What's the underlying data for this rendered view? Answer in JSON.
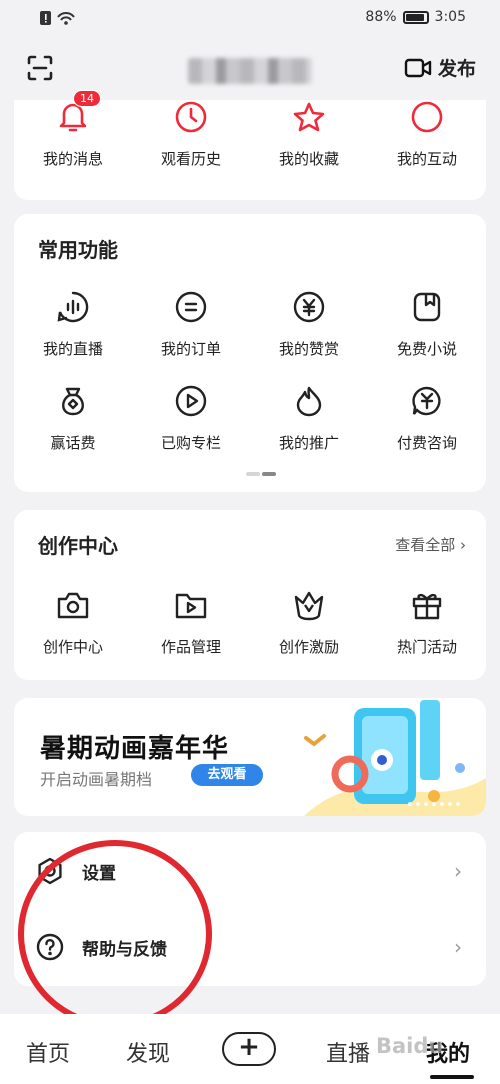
{
  "status": {
    "battery": "88%",
    "time": "3:05"
  },
  "header": {
    "publish_label": "发布"
  },
  "top_row": [
    {
      "label": "我的消息",
      "icon": "bell-icon",
      "badge": "14"
    },
    {
      "label": "观看历史",
      "icon": "clock-icon"
    },
    {
      "label": "我的收藏",
      "icon": "star-icon"
    },
    {
      "label": "我的互动",
      "icon": "circle-icon"
    }
  ],
  "common": {
    "title": "常用功能",
    "row1": [
      "我的直播",
      "我的订单",
      "我的赞赏",
      "免费小说"
    ],
    "row2": [
      "赢话费",
      "已购专栏",
      "我的推广",
      "付费咨询"
    ]
  },
  "creation": {
    "title": "创作中心",
    "view_all": "查看全部",
    "items": [
      "创作中心",
      "作品管理",
      "创作激励",
      "热门活动"
    ]
  },
  "banner": {
    "title": "暑期动画嘉年华",
    "subtitle": "开启动画暑期档",
    "button": "去观看"
  },
  "settings_list": [
    {
      "label": "设置",
      "icon": "settings-icon"
    },
    {
      "label": "帮助与反馈",
      "icon": "help-icon"
    }
  ],
  "tabs": {
    "home": "首页",
    "discover": "发现",
    "plus": "+",
    "live": "直播",
    "mine": "我的"
  },
  "watermark": "Baidu",
  "colors": {
    "accent_red": "#ef2b3a",
    "button_blue": "#2f86e8",
    "annotation_red": "#e02830"
  }
}
